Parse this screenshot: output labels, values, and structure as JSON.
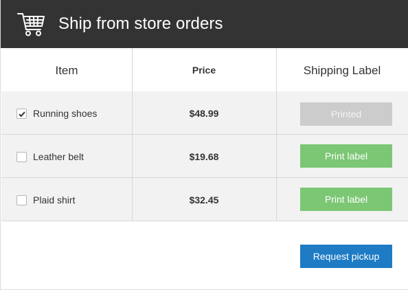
{
  "header": {
    "icon": "shopping-cart-icon",
    "title": "Ship from store orders",
    "background": "#333333"
  },
  "table": {
    "columns": [
      "Item",
      "Price",
      "Shipping Label"
    ],
    "rows": [
      {
        "checked": true,
        "item": "Running shoes",
        "price": "$48.99",
        "action": "Printed",
        "action_state": "disabled"
      },
      {
        "checked": false,
        "item": "Leather belt",
        "price": "$19.68",
        "action": "Print label",
        "action_state": "enabled"
      },
      {
        "checked": false,
        "item": "Plaid shirt",
        "price": "$32.45",
        "action": "Print label",
        "action_state": "enabled"
      }
    ]
  },
  "footer": {
    "pickup_label": "Request pickup"
  },
  "colors": {
    "print_button": "#7bc774",
    "printed_button": "#cccccc",
    "pickup_button": "#1e7bc4",
    "row_background": "#f2f2f2"
  }
}
